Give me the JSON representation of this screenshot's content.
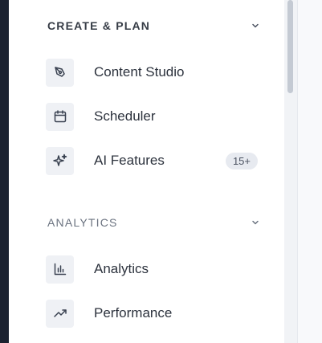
{
  "sections": [
    {
      "title": "CREATE & PLAN",
      "items": [
        {
          "label": "Content Studio",
          "icon": "pen-nib-icon"
        },
        {
          "label": "Scheduler",
          "icon": "calendar-icon"
        },
        {
          "label": "AI Features",
          "icon": "sparkles-icon",
          "badge": "15+"
        }
      ]
    },
    {
      "title": "ANALYTICS",
      "items": [
        {
          "label": "Analytics",
          "icon": "bar-chart-icon"
        },
        {
          "label": "Performance",
          "icon": "trending-up-icon"
        }
      ]
    }
  ],
  "colors": {
    "text": "#2c323d",
    "icon_bg": "#eff1f5",
    "badge_bg": "#e7eaf0",
    "left_edge": "#1b2230"
  }
}
